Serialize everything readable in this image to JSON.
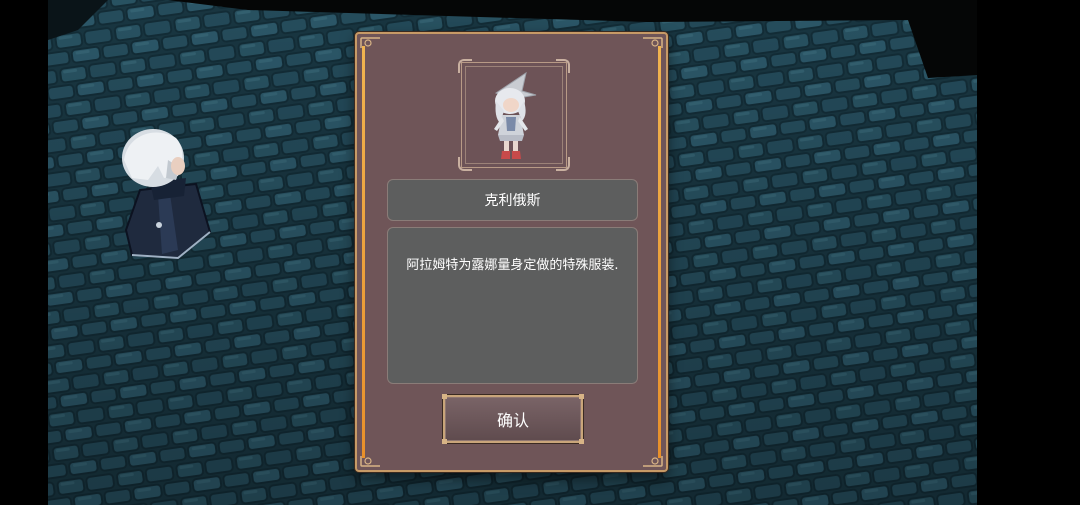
{
  "dialog": {
    "item_name": "克利俄斯",
    "description": "阿拉姆特为露娜量身定做的特殊服装.",
    "confirm_label": "确认"
  },
  "colors": {
    "dialog_bg": "#6f5558",
    "frame_gold": "#c79a66",
    "accent_orange": "#e8902a",
    "text_box_bg": "#5d5e5e",
    "floor_blue": "#1f4350"
  },
  "icons": {
    "portrait": "costume-portrait-icon",
    "character": "player-character"
  }
}
